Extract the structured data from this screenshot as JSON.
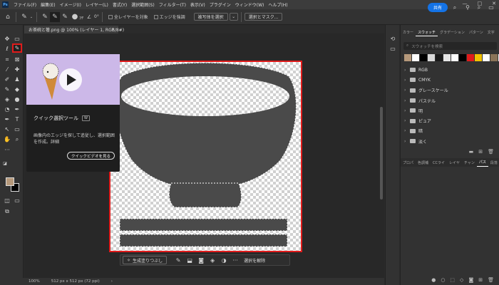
{
  "app": {
    "logo": "Ps"
  },
  "menu": [
    "ファイル(F)",
    "編集(E)",
    "イメージ(I)",
    "レイヤー(L)",
    "書式(Y)",
    "選択範囲(S)",
    "フィルター(T)",
    "表示(V)",
    "プラグイン",
    "ウィンドウ(W)",
    "ヘルプ(H)"
  ],
  "window_controls": [
    "—",
    "□",
    "✕"
  ],
  "options": {
    "brush_size": "37",
    "angle": "0°",
    "sample_all_layers": "全レイヤーを対象",
    "enhance_edge": "エッジを強調",
    "select_subject": "被写体を選択",
    "select_and_mask": "選択とマスク...",
    "share": "共有"
  },
  "document": {
    "tab_title": "お茶碗と箸.png @ 100% (レイヤー 1, RGB/8#)"
  },
  "tooltip": {
    "title": "クイック選択ツール",
    "shortcut": "W",
    "description": "画像内のエッジを探して追従し、選択範囲を作成。詳細",
    "video_button": "クイックビデオを見る"
  },
  "taskbar": {
    "generative_fill": "生成塗りつぶし",
    "deselect": "選択を解除",
    "more": "···"
  },
  "status": {
    "zoom": "100%",
    "size": "512 px x 512 px (72 ppi)"
  },
  "panel": {
    "tabs": [
      "カラー",
      "スウォッチ",
      "グラデーション",
      "パターン",
      "文字"
    ],
    "active_tab": "スウォッチ",
    "search_placeholder": "スウォッチを検索",
    "recent_colors": [
      "#b6997b",
      "#ffffff",
      "#000000",
      "#d9d9d9",
      "#1a1a1a",
      "#e6e6e6",
      "#ffffff",
      "#000000",
      "#e01b1b",
      "#f2c200",
      "#ffffff",
      "#8a7458",
      "#ffffff"
    ],
    "folders": [
      "RGB",
      "CMYK",
      "グレースケール",
      "パステル",
      "明",
      "ピュア",
      "暗",
      "淡く"
    ],
    "tabs2": [
      "プロパ",
      "色調補",
      "CCライ",
      "レイヤ",
      "チャン",
      "パス",
      "段落"
    ],
    "active_tab2": "パス"
  }
}
